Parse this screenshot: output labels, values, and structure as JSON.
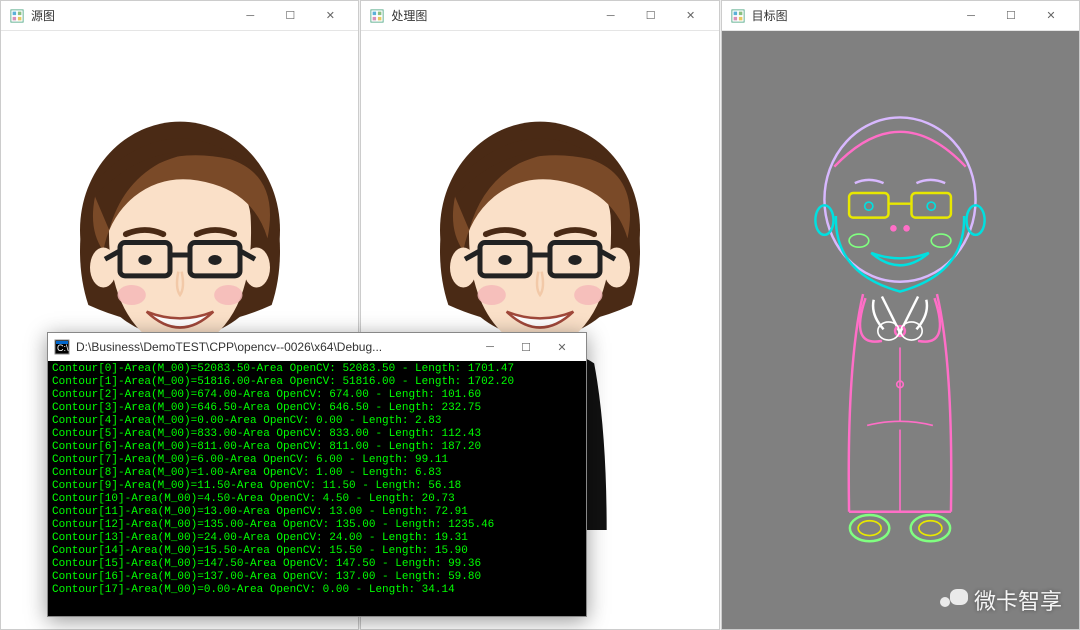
{
  "windows": [
    {
      "title": "源图",
      "bg": "white",
      "kind": "avatar"
    },
    {
      "title": "处理图",
      "bg": "white",
      "kind": "avatar"
    },
    {
      "title": "目标图",
      "bg": "gray",
      "kind": "outline"
    }
  ],
  "console": {
    "title": "D:\\Business\\DemoTEST\\CPP\\opencv--0026\\x64\\Debug...",
    "lines": [
      "Contour[0]-Area(M_00)=52083.50-Area OpenCV: 52083.50 - Length: 1701.47",
      "Contour[1]-Area(M_00)=51816.00-Area OpenCV: 51816.00 - Length: 1702.20",
      "Contour[2]-Area(M_00)=674.00-Area OpenCV: 674.00 - Length: 101.60",
      "Contour[3]-Area(M_00)=646.50-Area OpenCV: 646.50 - Length: 232.75",
      "Contour[4]-Area(M_00)=0.00-Area OpenCV: 0.00 - Length: 2.83",
      "Contour[5]-Area(M_00)=833.00-Area OpenCV: 833.00 - Length: 112.43",
      "Contour[6]-Area(M_00)=811.00-Area OpenCV: 811.00 - Length: 187.20",
      "Contour[7]-Area(M_00)=6.00-Area OpenCV: 6.00 - Length: 99.11",
      "Contour[8]-Area(M_00)=1.00-Area OpenCV: 1.00 - Length: 6.83",
      "Contour[9]-Area(M_00)=11.50-Area OpenCV: 11.50 - Length: 56.18",
      "Contour[10]-Area(M_00)=4.50-Area OpenCV: 4.50 - Length: 20.73",
      "Contour[11]-Area(M_00)=13.00-Area OpenCV: 13.00 - Length: 72.91",
      "Contour[12]-Area(M_00)=135.00-Area OpenCV: 135.00 - Length: 1235.46",
      "Contour[13]-Area(M_00)=24.00-Area OpenCV: 24.00 - Length: 19.31",
      "Contour[14]-Area(M_00)=15.50-Area OpenCV: 15.50 - Length: 15.90",
      "Contour[15]-Area(M_00)=147.50-Area OpenCV: 147.50 - Length: 99.36",
      "Contour[16]-Area(M_00)=137.00-Area OpenCV: 137.00 - Length: 59.80",
      "Contour[17]-Area(M_00)=0.00-Area OpenCV: 0.00 - Length: 34.14"
    ]
  },
  "watermark": {
    "text": "微卡智享"
  },
  "theme": {
    "hair": "#4a2a15",
    "hair_hi": "#7a4a28",
    "skin": "#fae0c8",
    "skin_shadow": "#f2c9a8",
    "blush": "#f5b8b8",
    "glasses": "#222",
    "suit": "#111",
    "outline_pink": "#ff6ec7",
    "outline_cyan": "#00e0e0",
    "outline_lav": "#d8b8ff",
    "outline_yel": "#e8e800",
    "outline_grn": "#80ff80",
    "outline_wht": "#ffffff"
  }
}
